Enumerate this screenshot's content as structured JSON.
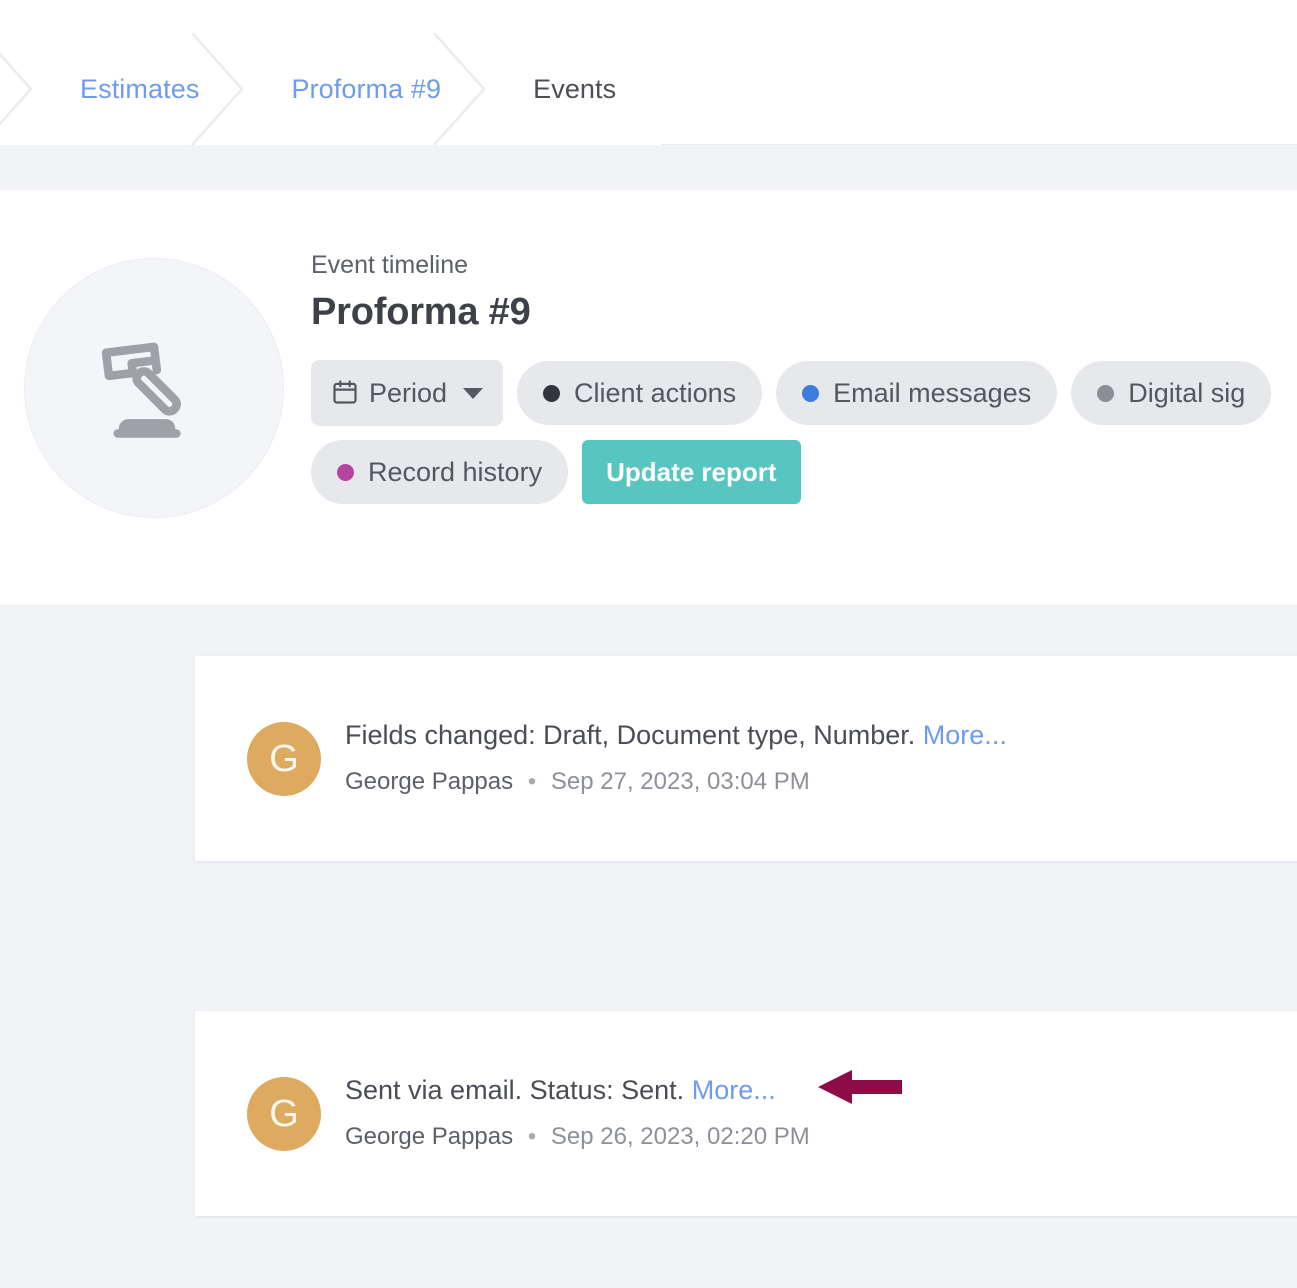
{
  "breadcrumb": {
    "home_icon": "home-icon",
    "items": [
      {
        "label": "Estimates",
        "state": "link"
      },
      {
        "label": "Proforma #9",
        "state": "link"
      },
      {
        "label": "Events",
        "state": "current"
      }
    ]
  },
  "header": {
    "icon": "gavel-icon",
    "eyebrow": "Event timeline",
    "title": "Proforma #9",
    "filters": [
      {
        "label": "Period",
        "icon": "calendar-icon",
        "type": "dropdown",
        "caret": "chevron-down-icon"
      },
      {
        "label": "Client actions",
        "dot_color": "#33363c",
        "type": "toggle"
      },
      {
        "label": "Email messages",
        "dot_color": "#3b7ddd",
        "type": "toggle"
      },
      {
        "label": "Digital sig",
        "dot_color": "#8a8f96",
        "type": "toggle"
      },
      {
        "label": "Record history",
        "dot_color": "#b5449f",
        "type": "toggle"
      }
    ],
    "update_button": "Update report"
  },
  "timeline": {
    "events": [
      {
        "avatar_initial": "G",
        "avatar_color": "#ddaa5f",
        "summary": "Fields changed: Draft, Document type, Number.",
        "more_label": "More...",
        "author": "George Pappas",
        "separator": "•",
        "timestamp": "Sep 27, 2023, 03:04 PM"
      },
      {
        "avatar_initial": "G",
        "avatar_color": "#ddaa5f",
        "summary": "Sent via email. Status: Sent.",
        "more_label": "More...",
        "author": "George Pappas",
        "separator": "•",
        "timestamp": "Sep 26, 2023, 02:20 PM"
      }
    ]
  },
  "annotation": {
    "arrow_color": "#8d0b46",
    "points_at": "More..."
  },
  "colors": {
    "accent_teal": "#57c5c0",
    "link_blue": "#6f9bef",
    "page_background": "#f2f3f7",
    "panel_background": "#ffffff",
    "pill_background": "#e7e8ec"
  }
}
